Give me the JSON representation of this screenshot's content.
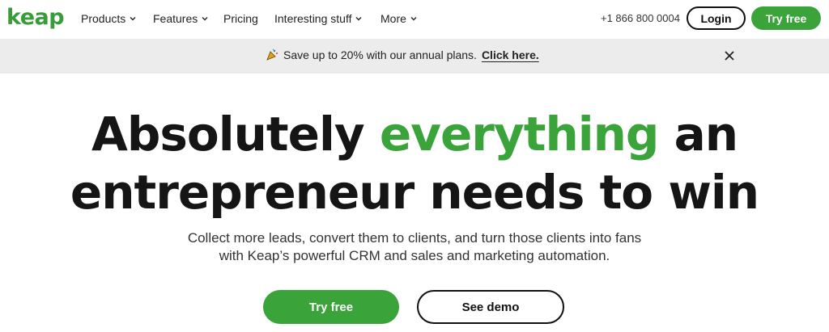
{
  "brand": {
    "logo_text": "keap",
    "accent": "#3aa33a"
  },
  "nav": {
    "items": [
      {
        "label": "Products",
        "dropdown": true
      },
      {
        "label": "Features",
        "dropdown": true
      },
      {
        "label": "Pricing",
        "dropdown": false
      },
      {
        "label": "Interesting stuff",
        "dropdown": true
      },
      {
        "label": "More",
        "dropdown": true
      }
    ],
    "phone": "+1 866 800 0004",
    "login_label": "Login",
    "try_label": "Try free"
  },
  "banner": {
    "icon": "party-popper-icon",
    "text": "Save up to 20% with our annual plans.",
    "link": "Click here."
  },
  "hero": {
    "line1_a": "Absolutely ",
    "line1_highlight": "everything",
    "line1_b": " an",
    "line2": "entrepreneur needs to win",
    "sub_line1": "Collect more leads, convert them to clients, and turn those clients into fans",
    "sub_line2": "with Keap’s powerful CRM and sales and marketing automation.",
    "cta_primary": "Try free",
    "cta_secondary": "See demo"
  }
}
